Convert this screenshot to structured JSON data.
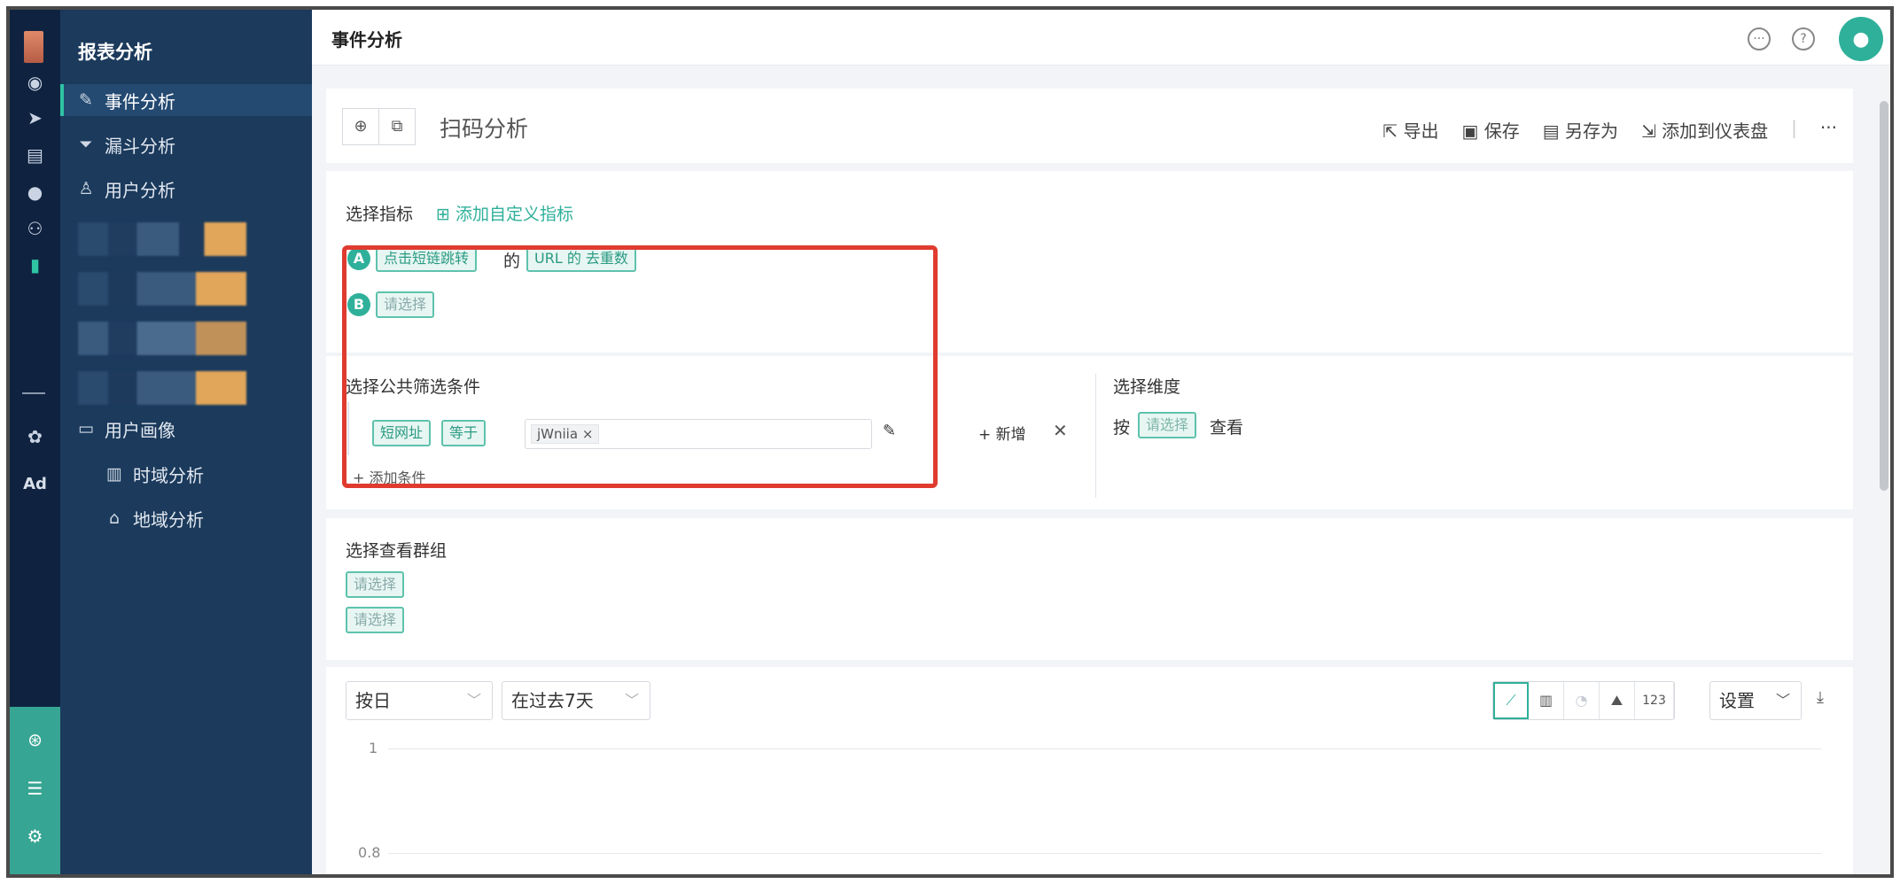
{
  "app": {
    "title": "报表分析"
  },
  "rail": {
    "icons": [
      "dashboard-icon",
      "send-icon",
      "layout-icon",
      "user-icon",
      "users-icon",
      "bar-chart-icon",
      "wechat-icon"
    ],
    "ad_label": "Ad",
    "bottom_icons": [
      "cog-wheel-icon",
      "server-icon",
      "settings-icon"
    ]
  },
  "sidebar": {
    "items": [
      {
        "label": "事件分析",
        "icon": "edit-doc-icon",
        "active": true
      },
      {
        "label": "漏斗分析",
        "icon": "funnel-icon"
      },
      {
        "label": "用户分析",
        "icon": "user-outline-icon"
      },
      {
        "label": "用户画像",
        "icon": "folder-icon"
      },
      {
        "label": "时域分析",
        "icon": "bar-chart-outline-icon"
      },
      {
        "label": "地域分析",
        "icon": "location-user-icon"
      }
    ]
  },
  "header": {
    "title": "事件分析"
  },
  "report": {
    "name": "扫码分析",
    "actions": {
      "export": "导出",
      "save": "保存",
      "save_as": "另存为",
      "add_dashboard": "添加到仪表盘",
      "more": "···"
    }
  },
  "metrics": {
    "label": "选择指标",
    "add_custom": "添加自定义指标",
    "a": {
      "badge": "A",
      "event": "点击短链跳转",
      "connector": "的",
      "measure": "URL 的 去重数"
    },
    "b": {
      "badge": "B",
      "placeholder": "请选择"
    }
  },
  "filters": {
    "label": "选择公共筛选条件",
    "field": "短网址",
    "operator": "等于",
    "value": "jWniia",
    "add_new": "+ 新增",
    "add_condition": "+ 添加条件"
  },
  "dimensions": {
    "label": "选择维度",
    "by": "按",
    "placeholder": "请选择",
    "view": "查看"
  },
  "groups": {
    "label": "选择查看群组",
    "placeholder1": "请选择",
    "placeholder2": "请选择"
  },
  "chart": {
    "granularity": "按日",
    "range": "在过去7天",
    "number_btn": "123",
    "settings": "设置",
    "y_ticks": [
      "1",
      "0.8"
    ]
  },
  "colors": {
    "accent": "#2fb09a",
    "sidebar": "#1b3a5c",
    "rail": "#0f2341",
    "highlight": "#e03b2f"
  }
}
